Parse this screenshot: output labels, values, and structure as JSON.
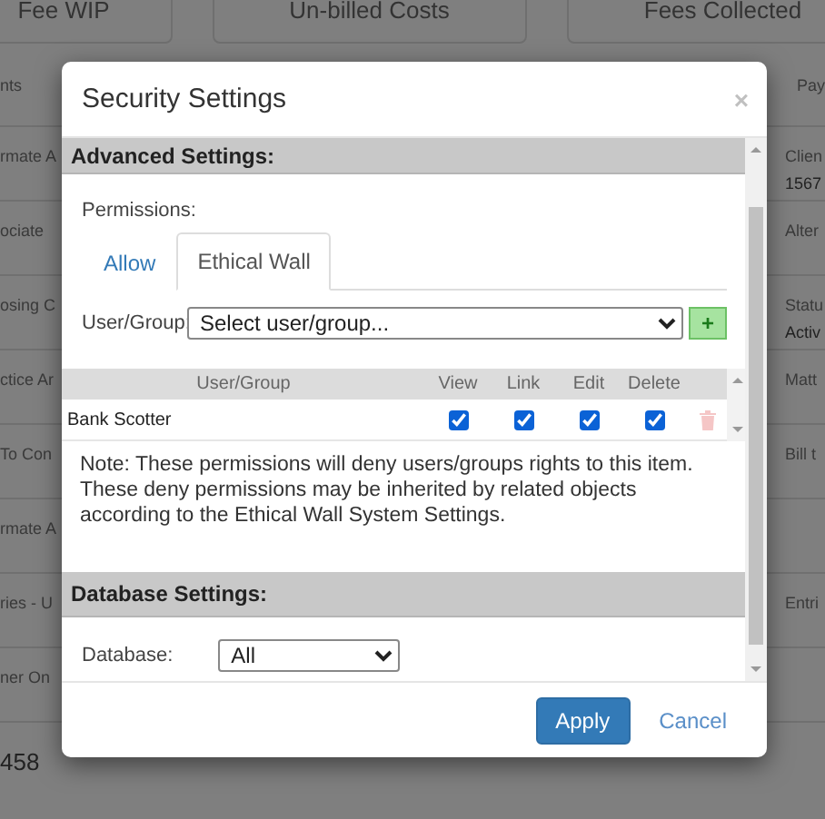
{
  "background": {
    "cards": [
      "Fee WIP",
      "Un-billed Costs",
      "Fees Collected"
    ],
    "tabs": [
      "nts",
      "Pay"
    ],
    "rows": [
      {
        "left": "rmate A",
        "right_label": "Clien",
        "right_value": "1567"
      },
      {
        "left": "ociate",
        "right_label": "Alter"
      },
      {
        "left": "osing C",
        "right_label": "Statu",
        "right_value": "Activ"
      },
      {
        "left": "ctice Ar",
        "right_label": "Matt"
      },
      {
        "left": "To Con",
        "right_label": "Bill t"
      },
      {
        "left": "rmate A"
      },
      {
        "left": "ries - U",
        "right_label": "Entri"
      },
      {
        "left": "ner On"
      }
    ],
    "footer": "458"
  },
  "dialog": {
    "title": "Security Settings",
    "close": "×",
    "advanced": {
      "heading": "Advanced Settings:",
      "permissions_label": "Permissions:",
      "tabs": [
        {
          "label": "Allow",
          "selected": false
        },
        {
          "label": "Ethical Wall",
          "selected": true
        }
      ],
      "user_group_label": "User/Group:",
      "user_group_value": "Select user/group...",
      "add_button": "+",
      "table": {
        "columns": [
          "User/Group",
          "View",
          "Link",
          "Edit",
          "Delete"
        ],
        "rows": [
          {
            "name": "Bank Scotter",
            "view": true,
            "link": true,
            "edit": true,
            "delete": true
          }
        ]
      },
      "note": "Note: These permissions will deny users/groups rights to this item. These deny permissions may be inherited by related objects according to the Ethical Wall System Settings."
    },
    "database": {
      "heading": "Database Settings:",
      "label": "Database:",
      "value": "All"
    },
    "buttons": [
      {
        "label": "Apply",
        "kind": "primary"
      },
      {
        "label": "Cancel",
        "kind": "link"
      }
    ]
  }
}
